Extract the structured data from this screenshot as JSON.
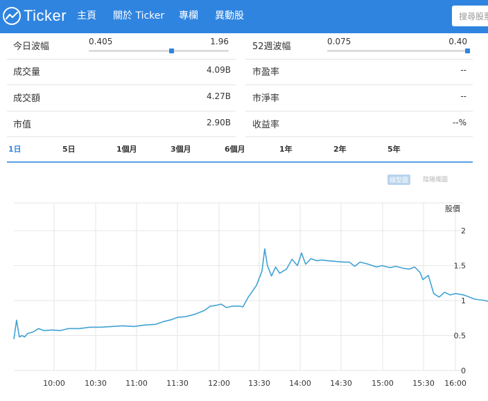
{
  "nav": {
    "logo_text": "Ticker",
    "items": [
      "主頁",
      "關於 Ticker",
      "專欄",
      "異動股"
    ],
    "search_placeholder": "搜尋股票"
  },
  "stats": {
    "day_range": {
      "label": "今日波幅",
      "low": "0.405",
      "high": "1.96",
      "position": 0.59
    },
    "week52_range": {
      "label": "52週波幅",
      "low": "0.075",
      "high": "0.40",
      "position": 1.0
    },
    "volume": {
      "label": "成交量",
      "value": "4.09B"
    },
    "turnover": {
      "label": "成交額",
      "value": "4.27B"
    },
    "market_cap": {
      "label": "市值",
      "value": "2.90B"
    },
    "pe_ratio": {
      "label": "市盈率",
      "value": "--"
    },
    "pb_ratio": {
      "label": "市淨率",
      "value": "--"
    },
    "yield": {
      "label": "收益率",
      "value": "--%"
    }
  },
  "tabs": [
    "1日",
    "5日",
    "1個月",
    "3個月",
    "6個月",
    "1年",
    "2年",
    "5年"
  ],
  "active_tab": 0,
  "chart_toggles": {
    "active": "線型圖",
    "inactive": "陰陽燭圖"
  },
  "colors": {
    "brand": "#2f84e0",
    "line": "#3fa2d4",
    "grid": "#e6e6e6"
  },
  "chart_data": {
    "type": "line",
    "ylabel": "股價",
    "ylim": [
      0,
      2
    ],
    "yticks": [
      "0",
      "0.5",
      "1",
      "1.5",
      "2"
    ],
    "xticks": [
      "10:00",
      "10:30",
      "11:00",
      "11:30",
      "12:00",
      "13:30",
      "14:00",
      "14:30",
      "15:00",
      "15:30",
      "16:00"
    ],
    "xlim": [
      0,
      330
    ],
    "grid": true,
    "series": [
      {
        "values": [
          [
            0,
            0.45
          ],
          [
            2,
            0.72
          ],
          [
            4,
            0.48
          ],
          [
            6,
            0.5
          ],
          [
            8,
            0.48
          ],
          [
            10,
            0.53
          ],
          [
            14,
            0.55
          ],
          [
            18,
            0.6
          ],
          [
            22,
            0.57
          ],
          [
            28,
            0.58
          ],
          [
            34,
            0.57
          ],
          [
            40,
            0.6
          ],
          [
            48,
            0.6
          ],
          [
            56,
            0.62
          ],
          [
            64,
            0.62
          ],
          [
            72,
            0.63
          ],
          [
            80,
            0.64
          ],
          [
            88,
            0.63
          ],
          [
            96,
            0.65
          ],
          [
            104,
            0.66
          ],
          [
            110,
            0.7
          ],
          [
            116,
            0.73
          ],
          [
            120,
            0.76
          ],
          [
            126,
            0.77
          ],
          [
            132,
            0.8
          ],
          [
            136,
            0.83
          ],
          [
            140,
            0.86
          ],
          [
            144,
            0.92
          ],
          [
            148,
            0.93
          ],
          [
            152,
            0.95
          ],
          [
            156,
            0.9
          ],
          [
            160,
            0.92
          ],
          [
            166,
            0.92
          ],
          [
            168,
            0.91
          ],
          [
            172,
            1.05
          ],
          [
            178,
            1.22
          ],
          [
            182,
            1.42
          ],
          [
            184,
            1.74
          ],
          [
            186,
            1.5
          ],
          [
            189,
            1.35
          ],
          [
            192,
            1.48
          ],
          [
            195,
            1.39
          ],
          [
            200,
            1.45
          ],
          [
            204,
            1.59
          ],
          [
            208,
            1.5
          ],
          [
            211,
            1.68
          ],
          [
            214,
            1.52
          ],
          [
            218,
            1.6
          ],
          [
            222,
            1.57
          ],
          [
            226,
            1.58
          ],
          [
            230,
            1.57
          ],
          [
            236,
            1.56
          ],
          [
            242,
            1.55
          ],
          [
            246,
            1.55
          ],
          [
            250,
            1.49
          ],
          [
            254,
            1.55
          ],
          [
            260,
            1.52
          ],
          [
            266,
            1.48
          ],
          [
            270,
            1.5
          ],
          [
            276,
            1.47
          ],
          [
            280,
            1.49
          ],
          [
            286,
            1.46
          ],
          [
            290,
            1.45
          ],
          [
            294,
            1.48
          ],
          [
            298,
            1.4
          ],
          [
            300,
            1.3
          ],
          [
            304,
            1.36
          ],
          [
            308,
            1.1
          ],
          [
            312,
            1.05
          ],
          [
            316,
            1.12
          ],
          [
            320,
            1.08
          ],
          [
            324,
            1.1
          ],
          [
            330,
            1.08
          ],
          [
            334,
            1.05
          ],
          [
            338,
            1.02
          ],
          [
            342,
            1.01
          ],
          [
            346,
            1.0
          ],
          [
            350,
            0.98
          ],
          [
            356,
            1.0
          ],
          [
            362,
            0.98
          ],
          [
            368,
            1.0
          ],
          [
            374,
            1.02
          ],
          [
            380,
            1.0
          ],
          [
            386,
            1.03
          ],
          [
            392,
            1.03
          ],
          [
            398,
            1.0
          ],
          [
            404,
            1.0
          ],
          [
            410,
            0.95
          ],
          [
            416,
            1.0
          ],
          [
            422,
            1.02
          ],
          [
            428,
            1.04
          ],
          [
            432,
            1.08
          ]
        ]
      }
    ]
  }
}
